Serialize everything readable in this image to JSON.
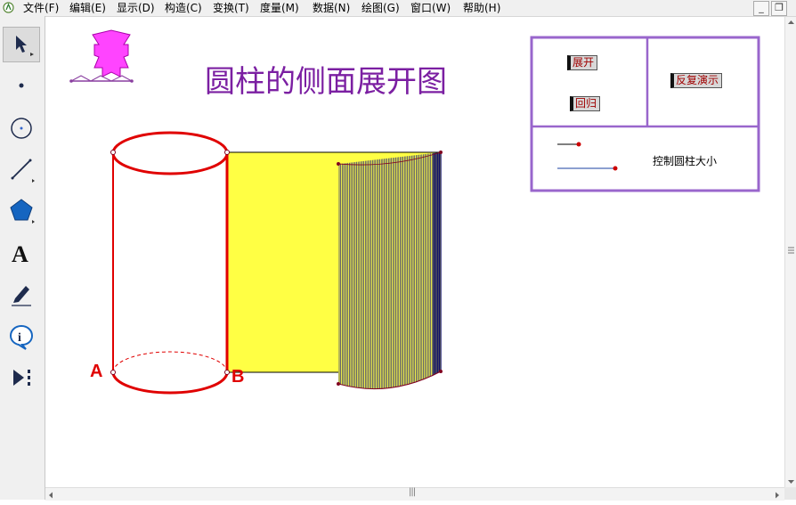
{
  "menu": [
    "文件(F)",
    "编辑(E)",
    "显示(D)",
    "构造(C)",
    "变换(T)",
    "度量(M)",
    "数据(N)",
    "绘图(G)",
    "窗口(W)",
    "帮助(H)"
  ],
  "window_controls": {
    "minimize": "_",
    "restore": "❐"
  },
  "tools": [
    "arrow-select",
    "point",
    "compass",
    "straightedge",
    "polygon",
    "text",
    "marker",
    "information",
    "custom-tools"
  ],
  "title": "圆柱的侧面展开图",
  "buttons": {
    "expand": "展开",
    "return": "回归",
    "repeat_demo": "反复演示"
  },
  "control_label": "控制圆柱大小",
  "points": {
    "a": "A",
    "b": "B"
  },
  "scrollbar_grip": "|||",
  "colors": {
    "accent": "#7b1fa2",
    "cylinder": "#e00000",
    "fill": "#ffff44",
    "stripes": "#1a1a80",
    "panel_border": "#9966cc"
  }
}
